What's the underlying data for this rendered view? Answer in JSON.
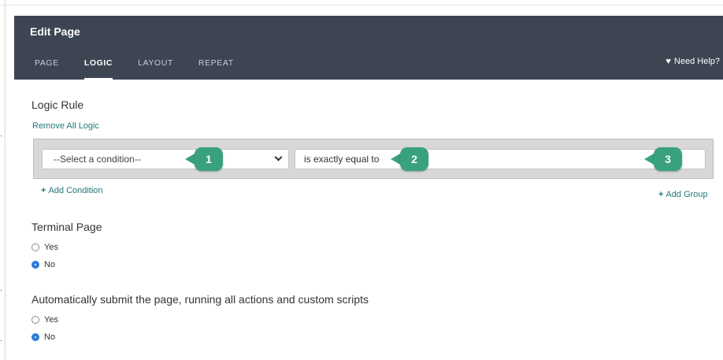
{
  "modal": {
    "title": "Edit Page",
    "tabs": [
      {
        "label": "PAGE",
        "active": false
      },
      {
        "label": "LOGIC",
        "active": true
      },
      {
        "label": "LAYOUT",
        "active": false
      },
      {
        "label": "REPEAT",
        "active": false
      }
    ],
    "help": {
      "label": "Need Help?",
      "icon": "heart-icon"
    }
  },
  "logic": {
    "title": "Logic Rule",
    "remove_all": "Remove All Logic",
    "condition_select": {
      "value": "--Select a condition--"
    },
    "operator": {
      "value": "is exactly equal to"
    },
    "callouts": [
      "1",
      "2",
      "3"
    ],
    "add_condition": "Add Condition",
    "add_group": "Add Group",
    "plus": "+"
  },
  "terminal": {
    "title": "Terminal Page",
    "options": [
      {
        "label": "Yes",
        "checked": false
      },
      {
        "label": "No",
        "checked": true
      }
    ]
  },
  "autosubmit": {
    "title": "Automatically submit the page, running all actions and custom scripts",
    "options": [
      {
        "label": "Yes",
        "checked": false
      },
      {
        "label": "No",
        "checked": true
      }
    ]
  },
  "colors": {
    "header_bg": "#3d4553",
    "link": "#23787a",
    "callout": "#39a27c",
    "radio_checked": "#2b7cd8"
  }
}
